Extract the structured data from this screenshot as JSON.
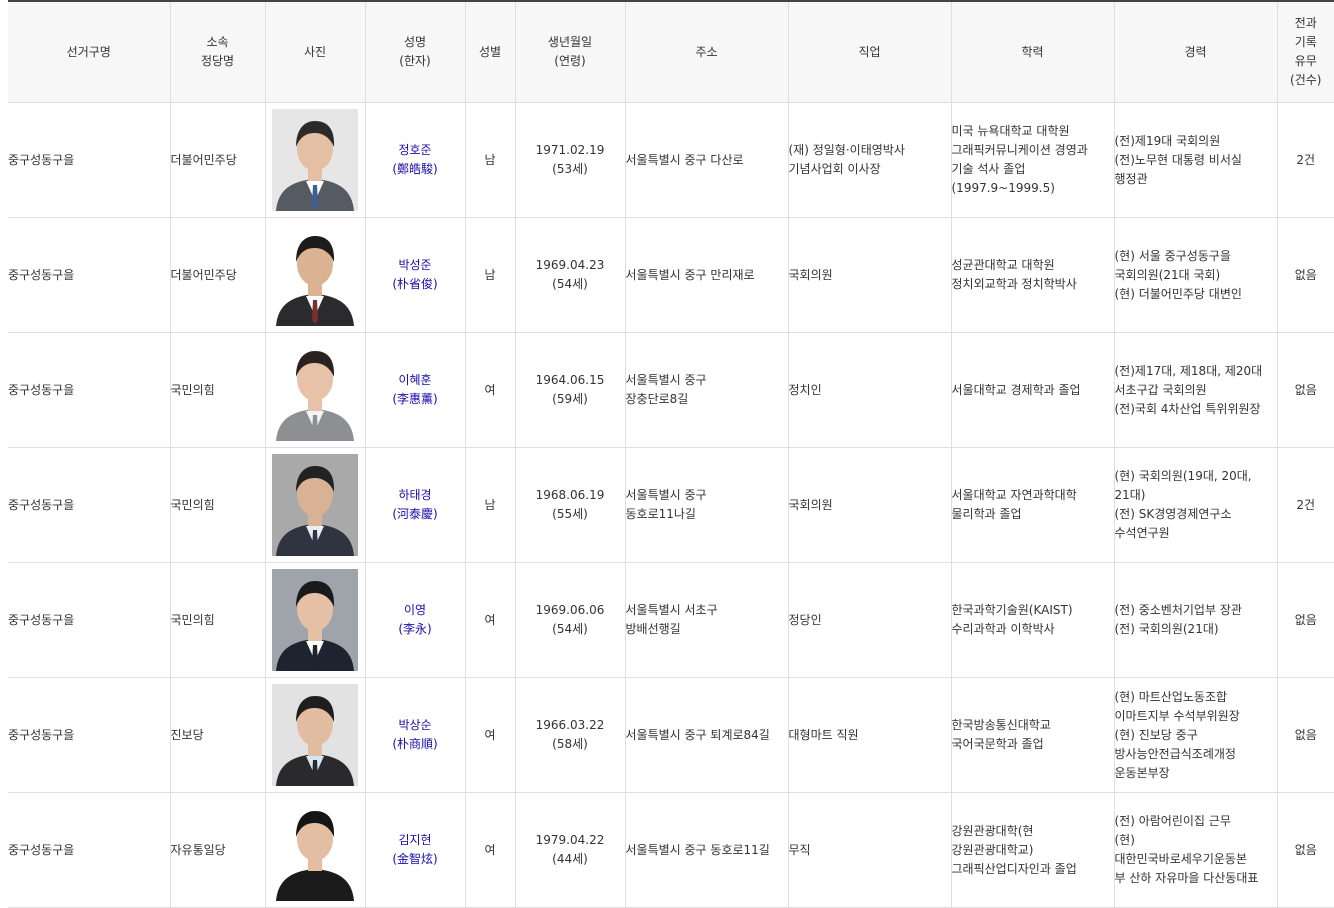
{
  "table": {
    "headers": {
      "district": "선거구명",
      "party": "소속\n정당명",
      "photo": "사진",
      "name": "성명\n(한자)",
      "gender": "성별",
      "birth": "생년월일\n(연령)",
      "address": "주소",
      "job": "직업",
      "education": "학력",
      "career": "경력",
      "record": "전과\n기록\n유무\n(건수)"
    },
    "rows": [
      {
        "district": "중구성동구을",
        "party": "더불어민주당",
        "name": "정호준",
        "hanja": "(鄭皓駿)",
        "gender": "남",
        "birth": "1971.02.19",
        "age": "(53세)",
        "address": "서울특별시 중구 다산로",
        "job": "(재) 정일형·이태영박사\n기념사업회 이사장",
        "education": "미국 뉴욕대학교 대학원\n그래픽커뮤니케이션 경영과\n기술 석사 졸업\n(1997.9~1999.5)",
        "career": "(전)제19대 국회의원\n(전)노무현 대통령 비서실\n행정관",
        "record": "2건",
        "photo": {
          "bg": "#e6e6e6",
          "suit": "#555a63",
          "shirt": "#ffffff",
          "tie": "#3f5f9a",
          "hair": "#2a2a2a",
          "skin": "#e4bfa3"
        }
      },
      {
        "district": "중구성동구을",
        "party": "더불어민주당",
        "name": "박성준",
        "hanja": "(朴省俊)",
        "gender": "남",
        "birth": "1969.04.23",
        "age": "(54세)",
        "address": "서울특별시 중구 만리재로",
        "job": "국회의원",
        "education": "성균관대학교 대학원\n정치외교학과 정치학박사",
        "career": "(현) 서울 중구성동구을\n국회의원(21대 국회)\n(현) 더불어민주당 대변인",
        "record": "없음",
        "photo": {
          "bg": "#ffffff",
          "suit": "#2b2b2e",
          "shirt": "#ffffff",
          "tie": "#7a2e2e",
          "hair": "#1c1c1c",
          "skin": "#dcb392"
        }
      },
      {
        "district": "중구성동구을",
        "party": "국민의힘",
        "name": "이혜훈",
        "hanja": "(李惠薰)",
        "gender": "여",
        "birth": "1964.06.15",
        "age": "(59세)",
        "address": "서울특별시 중구\n장충단로8길",
        "job": "정치인",
        "education": "서울대학교 경제학과 졸업",
        "career": "(전)제17대, 제18대, 제20대\n서초구갑 국회의원\n(전)국회 4차산업 특위위원장",
        "record": "없음",
        "photo": {
          "bg": "#ffffff",
          "suit": "#8d8f93",
          "shirt": "#f3f3f3",
          "tie": "#8d8f93",
          "hair": "#2a2220",
          "skin": "#e8c2a8"
        }
      },
      {
        "district": "중구성동구을",
        "party": "국민의힘",
        "name": "하태경",
        "hanja": "(河泰慶)",
        "gender": "남",
        "birth": "1968.06.19",
        "age": "(55세)",
        "address": "서울특별시 중구\n동호로11나길",
        "job": "국회의원",
        "education": "서울대학교 자연과학대학\n물리학과 졸업",
        "career": "(현) 국회의원(19대, 20대,\n21대)\n(전) SK경영경제연구소\n수석연구원",
        "record": "2건",
        "photo": {
          "bg": "#a9a9a9",
          "suit": "#2f3440",
          "shirt": "#e9eef5",
          "tie": "#2f3440",
          "hair": "#222222",
          "skin": "#d9b295"
        }
      },
      {
        "district": "중구성동구을",
        "party": "국민의힘",
        "name": "이영",
        "hanja": "(李永)",
        "gender": "여",
        "birth": "1969.06.06",
        "age": "(54세)",
        "address": "서울특별시 서초구\n방배선행길",
        "job": "정당인",
        "education": "한국과학기술원(KAIST)\n수리과학과 이학박사",
        "career": "(전) 중소벤처기업부 장관\n(전) 국회의원(21대)",
        "record": "없음",
        "photo": {
          "bg": "#9fa4ab",
          "suit": "#1e2330",
          "shirt": "#ffffff",
          "tie": "#1e2330",
          "hair": "#1a1a1a",
          "skin": "#e6c0a5"
        }
      },
      {
        "district": "중구성동구을",
        "party": "진보당",
        "name": "박상순",
        "hanja": "(朴商順)",
        "gender": "여",
        "birth": "1966.03.22",
        "age": "(58세)",
        "address": "서울특별시 중구 퇴계로84길",
        "job": "대형마트 직원",
        "education": "한국방송통신대학교\n국어국문학과 졸업",
        "career": "(현) 마트산업노동조합\n이마트지부 수석부위원장\n(현) 진보당 중구\n방사능안전급식조례개정\n운동본부장",
        "record": "없음",
        "photo": {
          "bg": "#e2e2e2",
          "suit": "#2a2a2c",
          "shirt": "#d8e6f3",
          "tie": "#2a2a2c",
          "hair": "#1e1e1e",
          "skin": "#e2bca0"
        }
      },
      {
        "district": "중구성동구을",
        "party": "자유통일당",
        "name": "김지현",
        "hanja": "(金智炫)",
        "gender": "여",
        "birth": "1979.04.22",
        "age": "(44세)",
        "address": "서울특별시 중구 동호로11길",
        "job": "무직",
        "education": "강원관광대학(현\n강원관광대학교)\n그래픽산업디자인과 졸업",
        "career": "(전) 아람어린이집 근무\n(현)\n대한민국바로세우기운동본\n부 산하 자유마을 다산동대표",
        "record": "없음",
        "photo": {
          "bg": "#ffffff",
          "suit": "#1b1b1b",
          "shirt": "#1b1b1b",
          "tie": "#1b1b1b",
          "hair": "#151515",
          "skin": "#e4bea3"
        }
      }
    ]
  }
}
